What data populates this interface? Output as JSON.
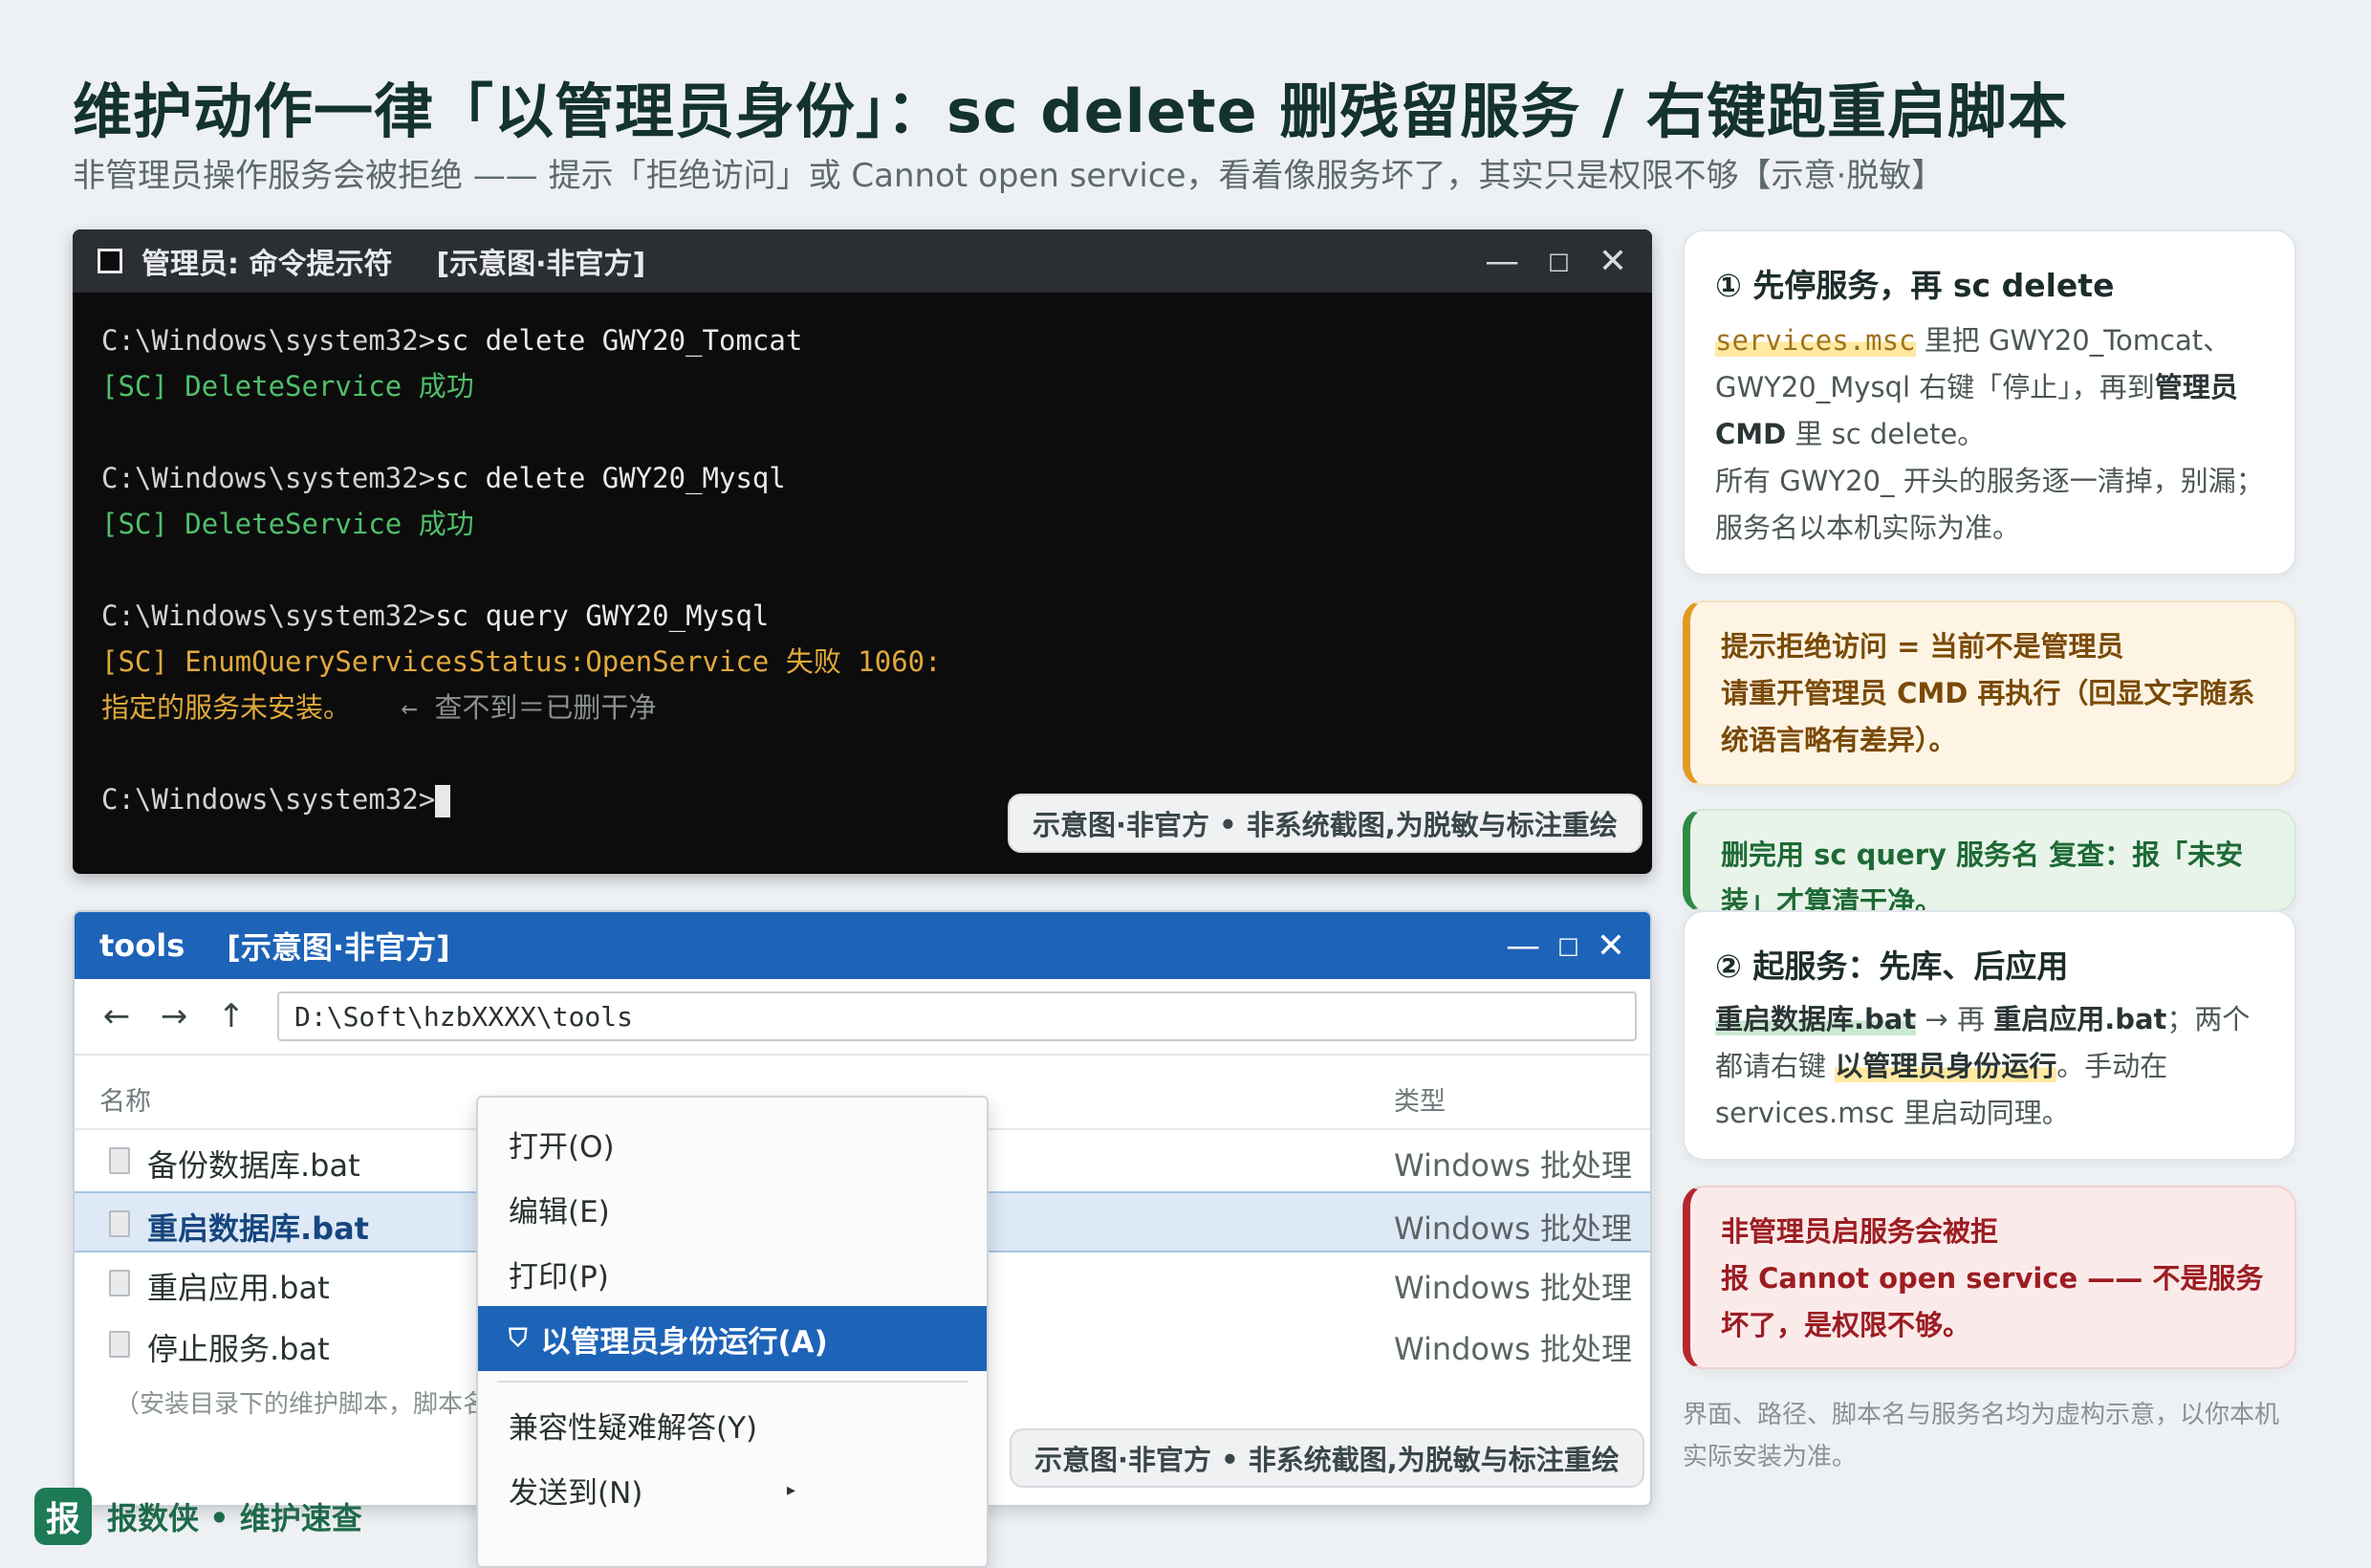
{
  "header": {
    "title": "维护动作一律「以管理员身份」：sc delete 删残留服务 / 右键跑重启脚本",
    "subtitle": "非管理员操作服务会被拒绝 —— 提示「拒绝访问」或 Cannot open service，看着像服务坏了，其实只是权限不够【示意·脱敏】"
  },
  "terminal": {
    "title": "管理员: 命令提示符",
    "tag": "[示意图·非官方]",
    "prompt": "C:\\Windows\\system32>",
    "cmd1": "sc delete GWY20_Tomcat",
    "out1": "[SC] DeleteService 成功",
    "cmd2": "sc delete GWY20_Mysql",
    "out2": "[SC] DeleteService 成功",
    "cmd3": "sc query GWY20_Mysql",
    "out3": "[SC] EnumQueryServicesStatus:OpenService 失败 1060:",
    "out4": "指定的服务未安装。",
    "out4_hint": "← 查不到＝已删干净",
    "badge": "示意图·非官方 • 非系统截图,为脱敏与标注重绘"
  },
  "explorer": {
    "title": "tools",
    "tag": "[示意图·非官方]",
    "path": "D:\\Soft\\hzbXXXX\\tools",
    "col_name": "名称",
    "col_type": "类型",
    "files": [
      {
        "name": "备份数据库.bat",
        "type": "Windows 批处理"
      },
      {
        "name": "重启数据库.bat",
        "type": "Windows 批处理"
      },
      {
        "name": "重启应用.bat",
        "type": "Windows 批处理"
      },
      {
        "name": "停止服务.bat",
        "type": "Windows 批处理"
      }
    ],
    "note": "（安装目录下的维护脚本，脚本名",
    "badge": "示意图·非官方 • 非系统截图,为脱敏与标注重绘"
  },
  "context_menu": {
    "items": [
      "打开(O)",
      "编辑(E)",
      "打印(P)",
      "以管理员身份运行(A)",
      "兼容性疑难解答(Y)",
      "发送到(N)"
    ]
  },
  "cards": {
    "c1_title": "① 先停服务，再 sc delete",
    "c1_a": "services.msc",
    "c1_b": " 里把 GWY20_Tomcat、GWY20_Mysql 右键「停止」，再到",
    "c1_c": "管理员 CMD",
    "c1_d": " 里 sc delete。",
    "c1_e": "所有 GWY20_ 开头的服务逐一清掉，别漏；服务名以本机实际为准。",
    "c2_text": "提示拒绝访问 = 当前不是管理员\n请重开管理员 CMD 再执行（回显文字随系统语言略有差异）。",
    "c3_text": "删完用 sc query 服务名 复查：报「未安装」才算清干净。",
    "c4_title": "② 起服务：先库、后应用",
    "c4_a": "重启数据库.bat",
    "c4_b": " → 再 ",
    "c4_c": "重启应用.bat",
    "c4_d": "；两个都请右键 ",
    "c4_e": "以管理员身份运行",
    "c4_f": "。手动在 services.msc 里启动同理。",
    "c5_text": "非管理员启服务会被拒\n报 Cannot open service —— 不是服务坏了，是权限不够。"
  },
  "bottom_note": "界面、路径、脚本名与服务名均为虚构示意，以你本机实际安装为准。",
  "brand": {
    "logo": "报",
    "name": "报数侠 • 维护速查"
  }
}
